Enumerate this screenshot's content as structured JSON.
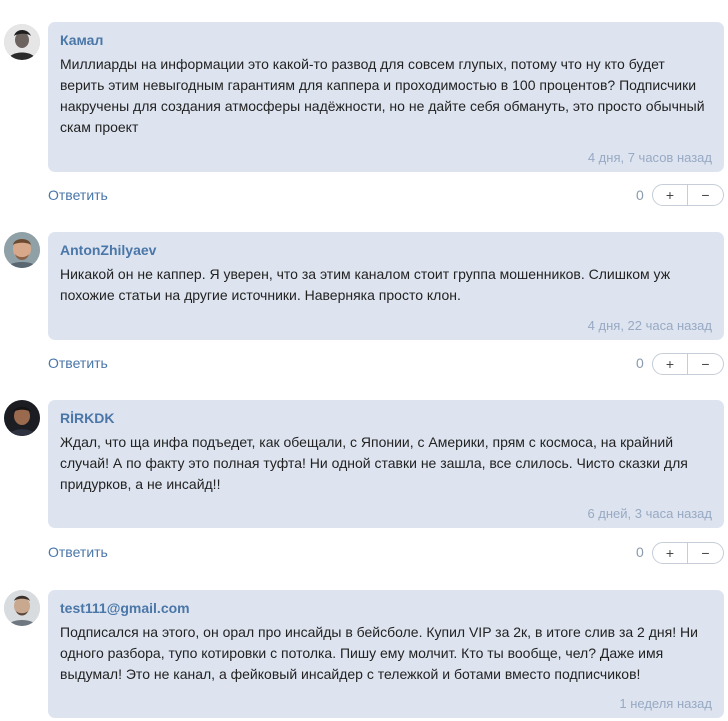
{
  "comments": [
    {
      "author": "Камал",
      "text": "Миллиарды на информации это какой-то развод для совсем глупых, потому что ну кто будет верить этим невыгодным гарантиям для каппера и проходимостью в 100 процентов? Подписчики накручены для создания атмосферы надёжности, но не дайте себя обмануть, это просто обычный скам проект",
      "time": "4 дня, 7 часов назад",
      "reply_label": "Ответить",
      "score": "0",
      "plus_label": "+",
      "minus_label": "−"
    },
    {
      "author": "AntonZhilyaev",
      "text": "Никакой он не каппер. Я уверен, что за этим каналом стоит группа мошенников. Слишком уж похожие статьи на другие источники. Наверняка просто клон.",
      "time": "4 дня, 22 часа назад",
      "reply_label": "Ответить",
      "score": "0",
      "plus_label": "+",
      "minus_label": "−"
    },
    {
      "author": "RİRKDK",
      "text": "Ждал, что ща инфа подъедет, как обещали, с Японии, с Америки, прям с космоса, на крайний случай! А по факту это полная туфта! Ни одной ставки не зашла, все слилось. Чисто сказки для придурков, а не инсайд!!",
      "time": "6 дней, 3 часа назад",
      "reply_label": "Ответить",
      "score": "0",
      "plus_label": "+",
      "minus_label": "−"
    },
    {
      "author": "test111@gmail.com",
      "text": "Подписался на этого, он орал про инсайды в бейсболе. Купил VIP за 2к, в итоге слив за 2 дня! Ни одного разбора, тупо котировки с потолка. Пишу ему молчит. Кто ты вообще, чел? Даже имя выдумал! Это не канал, а фейковый инсайдер с тележкой и ботами вместо подписчиков!",
      "time": "1 неделя назад"
    }
  ],
  "colors": {
    "bubble": "#dde4ef",
    "author": "#4a76a8",
    "time": "#97a9c3"
  }
}
